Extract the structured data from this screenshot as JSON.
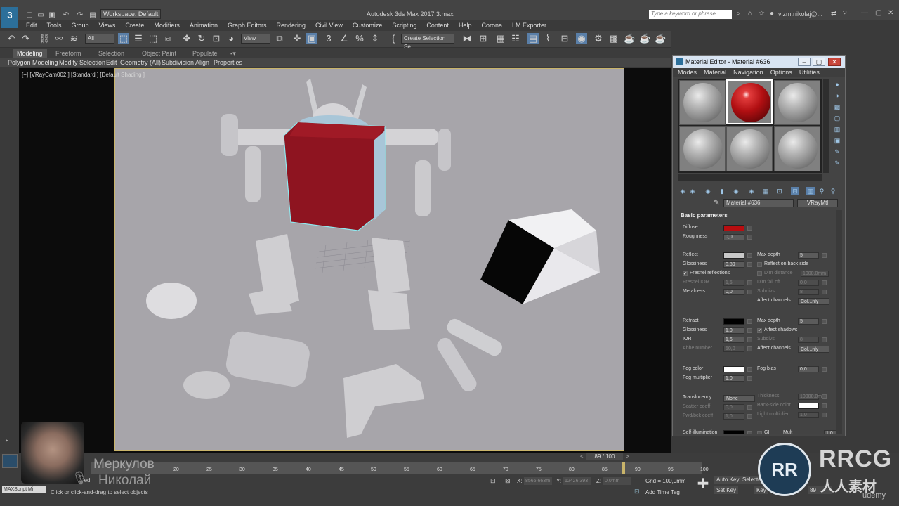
{
  "app": {
    "title": "Autodesk 3ds Max 2017    3.max",
    "logo": "3",
    "workspace": "Workspace: Default",
    "search_placeholder": "Type a keyword or phrase",
    "user": "vizm.nikolaj@...",
    "menus": [
      "Edit",
      "Tools",
      "Group",
      "Views",
      "Create",
      "Modifiers",
      "Animation",
      "Graph Editors",
      "Rendering",
      "Civil View",
      "Customize",
      "Scripting",
      "Content",
      "Help",
      "Corona",
      "LM Exporter"
    ]
  },
  "toolbar": {
    "selection_filter": "All",
    "reference_coord": "View",
    "named_selection": "Create Selection Se"
  },
  "ribbon": {
    "tabs": [
      "Modeling",
      "Freeform",
      "Selection",
      "Object Paint",
      "Populate"
    ],
    "sub_items": [
      "Polygon Modeling",
      "Modify Selection",
      "Edit",
      "Geometry (All)",
      "Subdivision",
      "Align",
      "Properties"
    ]
  },
  "viewport": {
    "label": "[+] [VRayCam002 ] [Standard ] [Default Shading ]"
  },
  "material_editor": {
    "title": "Material Editor - Material #636",
    "menus": [
      "Modes",
      "Material",
      "Navigation",
      "Options",
      "Utilities"
    ],
    "material_name": "Material #636",
    "material_type": "VRayMtl",
    "section": "Basic parameters",
    "left_params": [
      {
        "label": "Diffuse",
        "type": "swatch",
        "color": "#b80d10"
      },
      {
        "label": "Roughness",
        "type": "value",
        "value": "0,0"
      },
      {
        "label": "Reflect",
        "type": "swatch",
        "color": "#c8c8c8"
      },
      {
        "label": "Glossiness",
        "type": "value",
        "value": "0,89"
      },
      {
        "label": "Fresnel reflections",
        "type": "check",
        "checked": "✔"
      },
      {
        "label": "Fresnel IOR",
        "type": "value",
        "value": "1,6",
        "dim": true
      },
      {
        "label": "Metalness",
        "type": "value",
        "value": "0,0"
      },
      {
        "label": "Refract",
        "type": "swatch",
        "color": "#000000"
      },
      {
        "label": "Glossiness",
        "type": "value",
        "value": "1,0"
      },
      {
        "label": "IOR",
        "type": "value",
        "value": "1,6"
      },
      {
        "label": "Abbe number",
        "type": "value",
        "value": "50,0",
        "dim": true
      },
      {
        "label": "Fog color",
        "type": "swatch",
        "color": "#ffffff"
      },
      {
        "label": "Fog multiplier",
        "type": "value",
        "value": "1,0"
      },
      {
        "label": "Translucency",
        "type": "dropdown",
        "value": "None"
      },
      {
        "label": "Scatter coeff",
        "type": "value",
        "value": "0,0",
        "dim": true
      },
      {
        "label": "Fwd/bck coeff",
        "type": "value",
        "value": "1,0",
        "dim": true
      },
      {
        "label": "Self-illumination",
        "type": "swatch",
        "color": "#000000"
      }
    ],
    "right_params": [
      {
        "label": "Max depth",
        "type": "value",
        "value": "5"
      },
      {
        "label": "Reflect on back side",
        "type": "check",
        "checked": ""
      },
      {
        "label": "Dim distance",
        "type": "checkvalue",
        "value": "1000,0mm",
        "dim": true
      },
      {
        "label": "Dim fall off",
        "type": "value",
        "value": "0,0",
        "dim": true
      },
      {
        "label": "Subdivs",
        "type": "value",
        "value": "8",
        "dim": true
      },
      {
        "label": "Affect channels",
        "type": "dropdown",
        "value": "Col...nly"
      },
      {
        "label": "Max depth",
        "type": "value",
        "value": "5"
      },
      {
        "label": "Affect shadows",
        "type": "check",
        "checked": "✔"
      },
      {
        "label": "Subdivs",
        "type": "value",
        "value": "8",
        "dim": true
      },
      {
        "label": "Affect channels",
        "type": "dropdown",
        "value": "Col...nly"
      },
      {
        "label": "Fog bias",
        "type": "value",
        "value": "0,0"
      },
      {
        "label": "Thickness",
        "type": "value",
        "value": "10000,0m",
        "dim": true
      },
      {
        "label": "Back-side color",
        "type": "swatch",
        "color": "#ffffff",
        "dim": true
      },
      {
        "label": "Light multiplier",
        "type": "value",
        "value": "1,0",
        "dim": true
      },
      {
        "label": "GI",
        "type": "check",
        "checked": ""
      },
      {
        "label": "Mult",
        "type": "value",
        "value": "1,0"
      }
    ]
  },
  "timeline": {
    "frame_counter": "89 / 100",
    "ticks": [
      "20",
      "25",
      "30",
      "35",
      "40",
      "45",
      "50",
      "55",
      "60",
      "65",
      "70",
      "75",
      "80",
      "85",
      "90",
      "95",
      "100"
    ],
    "maxscript": "MAXScript Mi",
    "status_line1": "Object Selected",
    "status_line2": "Click or click-and-drag to select objects",
    "x_label": "X:",
    "x_value": "8565,663m",
    "y_label": "Y:",
    "y_value": "12426,393",
    "z_label": "Z:",
    "z_value": "0,0mm",
    "grid": "Grid = 100,0mm",
    "add_time_tag": "Add Time Tag",
    "auto_key": "Auto Key",
    "set_key": "Set Key",
    "selected": "Selecte",
    "key_filters": "Key",
    "current_frame": "89"
  },
  "overlay": {
    "presenter_first": "Меркулов",
    "presenter_last": "Николай",
    "watermark": "RRCG",
    "watermark_sub": "人人素材",
    "udemy": "udemy"
  }
}
